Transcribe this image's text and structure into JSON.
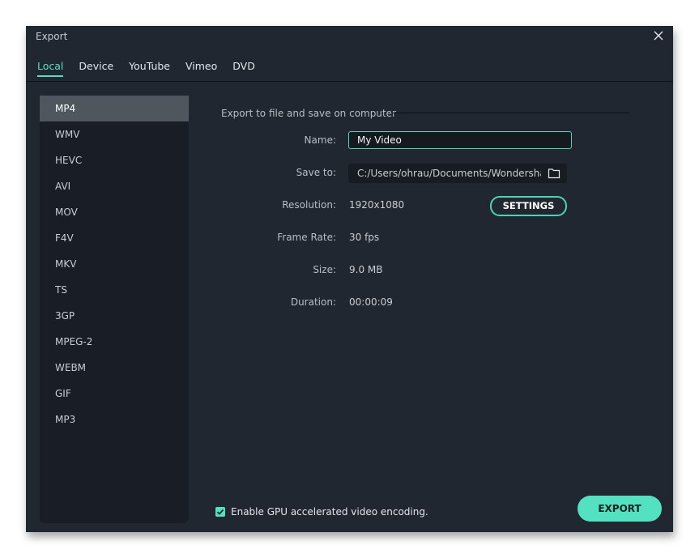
{
  "window": {
    "title": "Export"
  },
  "tabs": [
    {
      "label": "Local",
      "active": true
    },
    {
      "label": "Device",
      "active": false
    },
    {
      "label": "YouTube",
      "active": false
    },
    {
      "label": "Vimeo",
      "active": false
    },
    {
      "label": "DVD",
      "active": false
    }
  ],
  "formats": [
    "MP4",
    "WMV",
    "HEVC",
    "AVI",
    "MOV",
    "F4V",
    "MKV",
    "TS",
    "3GP",
    "MPEG-2",
    "WEBM",
    "GIF",
    "MP3"
  ],
  "selected_format": "MP4",
  "section_title": "Export to file and save on computer",
  "fields": {
    "name": {
      "label": "Name:",
      "value": "My Video"
    },
    "save_to": {
      "label": "Save to:",
      "value": "C:/Users/ohrau/Documents/Wondershare"
    },
    "resolution": {
      "label": "Resolution:",
      "value": "1920x1080"
    },
    "frame_rate": {
      "label": "Frame Rate:",
      "value": "30 fps"
    },
    "size": {
      "label": "Size:",
      "value": "9.0 MB"
    },
    "duration": {
      "label": "Duration:",
      "value": "00:00:09"
    }
  },
  "buttons": {
    "settings": "SETTINGS",
    "export": "EXPORT"
  },
  "gpu": {
    "label": "Enable GPU accelerated video encoding.",
    "checked": true
  },
  "colors": {
    "accent": "#52e2c1",
    "background": "#212731",
    "sidebar": "#191e26",
    "selected": "#50565d"
  }
}
